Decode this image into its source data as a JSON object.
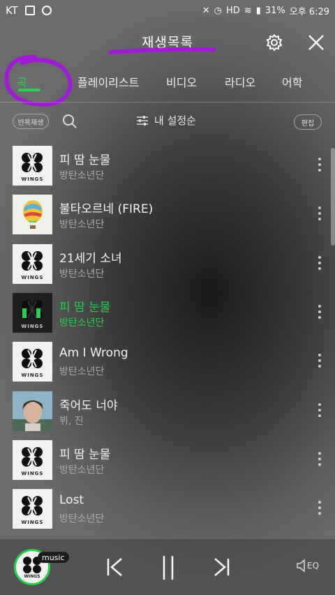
{
  "status_bar": {
    "carrier": "KT",
    "battery": "31%",
    "time": "오후 6:29"
  },
  "header": {
    "title": "재생목록"
  },
  "tabs": [
    {
      "label": "곡",
      "active": true
    },
    {
      "label": "플레이리스트",
      "active": false
    },
    {
      "label": "비디오",
      "active": false
    },
    {
      "label": "라디오",
      "active": false
    },
    {
      "label": "어학",
      "active": false
    }
  ],
  "toolbar": {
    "repeat_label": "반복재생",
    "sort_label": "내 설정순",
    "edit_label": "편집"
  },
  "songs": [
    {
      "title": "피 땀 눈물",
      "artist": "방탄소년단",
      "art": "wings"
    },
    {
      "title": "불타오르네 (FIRE)",
      "artist": "방탄소년단",
      "art": "balloon"
    },
    {
      "title": "21세기 소녀",
      "artist": "방탄소년단",
      "art": "wings"
    },
    {
      "title": "피 땀 눈물",
      "artist": "방탄소년단",
      "art": "wings-dark",
      "playing": true
    },
    {
      "title": "Am I Wrong",
      "artist": "방탄소년단",
      "art": "wings"
    },
    {
      "title": "죽어도 너야",
      "artist": "뷔, 진",
      "art": "photo"
    },
    {
      "title": "피 땀 눈물",
      "artist": "방탄소년단",
      "art": "wings"
    },
    {
      "title": "Lost",
      "artist": "방탄소년단",
      "art": "wings"
    }
  ],
  "album_text": "WINGS",
  "player": {
    "badge": "music",
    "eq_label": "EQ"
  },
  "colors": {
    "accent": "#27d14b",
    "annotation": "#a11ad6"
  }
}
